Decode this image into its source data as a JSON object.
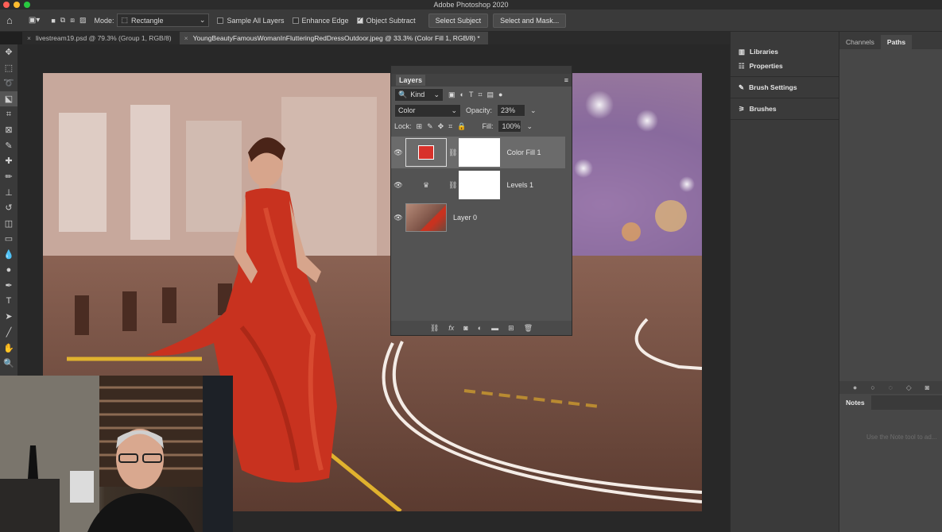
{
  "app": {
    "title": "Adobe Photoshop 2020"
  },
  "options": {
    "mode_label": "Mode:",
    "mode_value": "Rectangle",
    "sample_all_layers": "Sample All Layers",
    "enhance_edge": "Enhance Edge",
    "object_subtract": "Object Subtract",
    "select_subject": "Select Subject",
    "select_and_mask": "Select and Mask..."
  },
  "tabs": [
    {
      "label": "livestream19.psd @ 79.3% (Group 1, RGB/8)"
    },
    {
      "label": "YoungBeautyFamousWomanInFlutteringRedDressOutdoor.jpeg @ 33.3% (Color Fill 1, RGB/8) *"
    }
  ],
  "layers_panel": {
    "title": "Layers",
    "filter": "Kind",
    "blend_mode": "Color",
    "opacity_label": "Opacity:",
    "opacity_value": "23%",
    "lock_label": "Lock:",
    "fill_label": "Fill:",
    "fill_value": "100%",
    "layers": [
      {
        "name": "Color Fill 1"
      },
      {
        "name": "Levels 1"
      },
      {
        "name": "Layer 0"
      }
    ]
  },
  "dock": {
    "items": [
      {
        "label": "Libraries"
      },
      {
        "label": "Properties"
      },
      {
        "label": "Brush Settings"
      },
      {
        "label": "Brushes"
      }
    ]
  },
  "right_panel": {
    "tabs": [
      "Channels",
      "Paths"
    ],
    "notes_tab": "Notes",
    "notes_hint": "Use the Note tool to ad..."
  },
  "colors": {
    "color_fill_swatch": "#d8312a",
    "dress": "#c8321f"
  }
}
